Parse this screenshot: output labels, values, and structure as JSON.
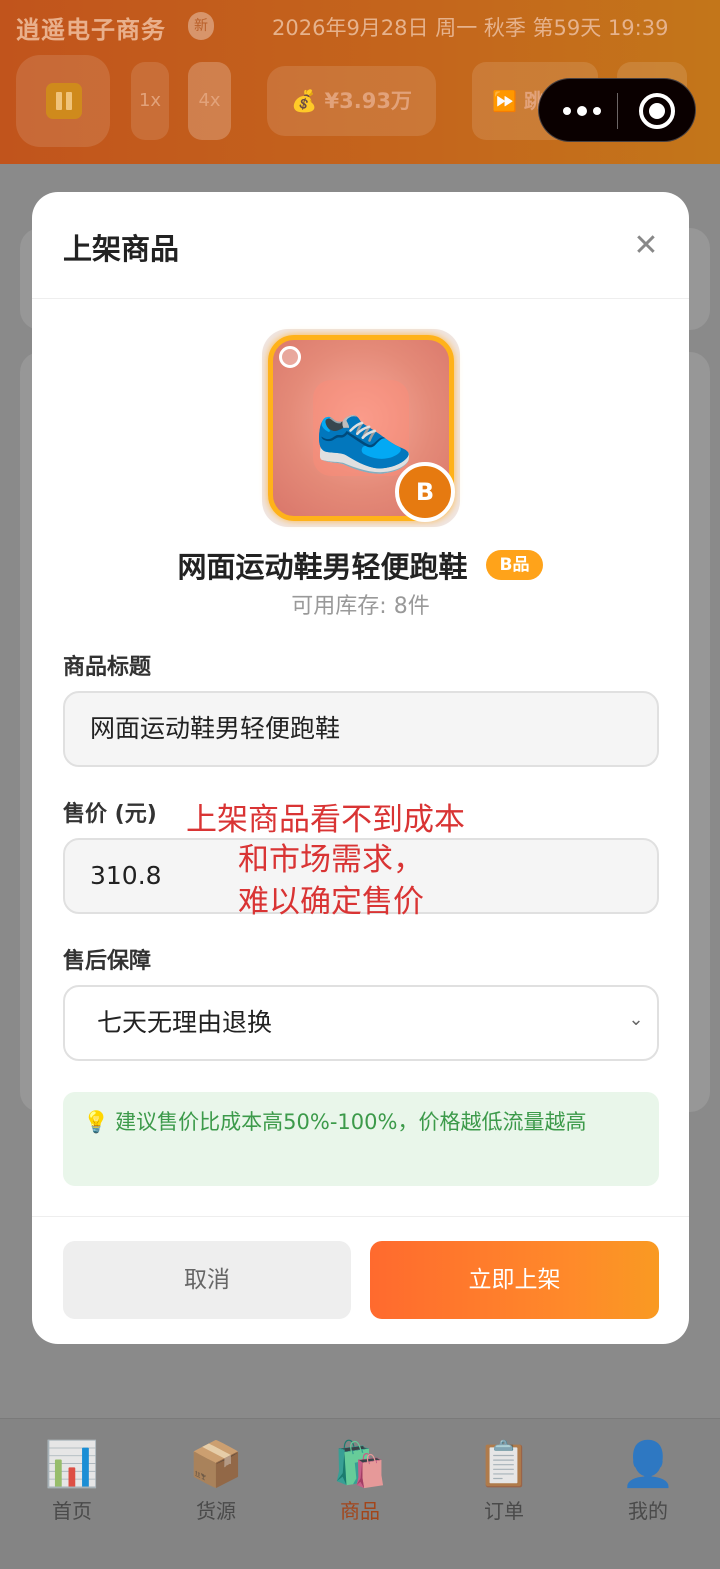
{
  "app": {
    "title": "逍遥电子商务",
    "badge": "新",
    "datetime": "2026年9月28日 周一 秋季 第59天 19:39",
    "speed_1x": "1x",
    "speed_4x": "4x",
    "money": "💰 ¥3.93万",
    "skip_label": "⏩ 跳1天"
  },
  "modal": {
    "title": "上架商品",
    "close_symbol": "✕",
    "product": {
      "emoji": "👟",
      "grade_badge": "B",
      "name": "网面运动鞋男轻便跑鞋",
      "grade_tag": "B品",
      "stock": "可用库存: 8件"
    },
    "fields": {
      "title_label": "商品标题",
      "title_value": "网面运动鞋男轻便跑鞋",
      "price_label": "售价 (元)",
      "price_value": "310.8",
      "warranty_label": "售后保障",
      "warranty_value": "七天无理由退换"
    },
    "annotation": {
      "line1": "上架商品看不到成本",
      "line2": "和市场需求，",
      "line3": "难以确定售价"
    },
    "tip": {
      "icon": "💡",
      "text": "建议售价比成本高50%-100%，价格越低流量越高"
    },
    "buttons": {
      "cancel": "取消",
      "confirm": "立即上架"
    }
  },
  "nav": [
    {
      "icon": "📊",
      "label": "首页"
    },
    {
      "icon": "📦",
      "label": "货源"
    },
    {
      "icon": "🛍️",
      "label": "商品"
    },
    {
      "icon": "📋",
      "label": "订单"
    },
    {
      "icon": "👤",
      "label": "我的"
    }
  ],
  "colors": {
    "accent": "#ff7a2a",
    "tip_text": "#3c9a4a",
    "annotation": "#d93434"
  }
}
